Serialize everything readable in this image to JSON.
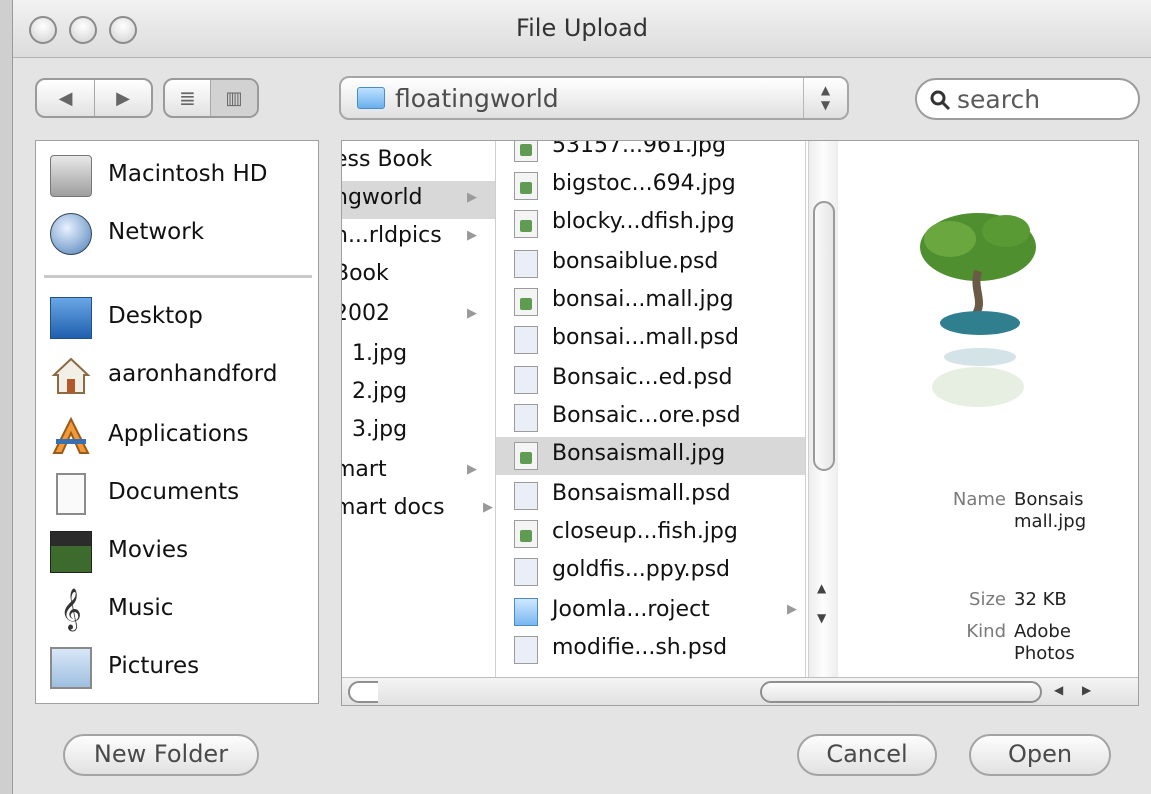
{
  "window": {
    "title": "File Upload"
  },
  "toolbar": {
    "path": "floatingworld",
    "search_placeholder": "search"
  },
  "sidebar": {
    "items": [
      {
        "label": "Macintosh HD",
        "icon": "hard-drive-icon"
      },
      {
        "label": "Network",
        "icon": "globe-icon"
      },
      {
        "label": "Desktop",
        "icon": "desktop-icon"
      },
      {
        "label": "aaronhandford",
        "icon": "home-icon"
      },
      {
        "label": "Applications",
        "icon": "applications-icon"
      },
      {
        "label": "Documents",
        "icon": "document-icon"
      },
      {
        "label": "Movies",
        "icon": "clapperboard-icon"
      },
      {
        "label": "Music",
        "icon": "music-note-icon"
      },
      {
        "label": "Pictures",
        "icon": "pictures-icon"
      }
    ]
  },
  "column1": [
    {
      "label": "ess Book",
      "arrow": ""
    },
    {
      "label": "ngworld",
      "arrow": "▶"
    },
    {
      "label": "n...rldpics",
      "arrow": "▶"
    },
    {
      "label": "Book",
      "arrow": ""
    },
    {
      "label": "2002",
      "arrow": "▶"
    },
    {
      "label": "1.jpg",
      "arrow": ""
    },
    {
      "label": "2.jpg",
      "arrow": ""
    },
    {
      "label": "3.jpg",
      "arrow": ""
    },
    {
      "label": "mart",
      "arrow": "▶"
    },
    {
      "label": "mart docs",
      "arrow": "▶"
    }
  ],
  "column2": [
    {
      "label": "53157...961.jpg",
      "kind": "img"
    },
    {
      "label": "bigstoc...694.jpg",
      "kind": "img"
    },
    {
      "label": "blocky...dfish.jpg",
      "kind": "img"
    },
    {
      "label": "bonsaiblue.psd",
      "kind": "psd"
    },
    {
      "label": "bonsai...mall.jpg",
      "kind": "img"
    },
    {
      "label": "bonsai...mall.psd",
      "kind": "psd"
    },
    {
      "label": "Bonsaic...ed.psd",
      "kind": "psd"
    },
    {
      "label": "Bonsaic...ore.psd",
      "kind": "psd"
    },
    {
      "label": "Bonsaismall.jpg",
      "kind": "img",
      "selected": true
    },
    {
      "label": "Bonsaismall.psd",
      "kind": "psd"
    },
    {
      "label": "closeup...fish.jpg",
      "kind": "img"
    },
    {
      "label": "goldfis...ppy.psd",
      "kind": "psd"
    },
    {
      "label": "Joomla...roject",
      "kind": "folder",
      "arrow": "▶"
    },
    {
      "label": "modifie...sh.psd",
      "kind": "psd"
    }
  ],
  "preview": {
    "name_label": "Name",
    "name_value": "Bonsaismall.jpg",
    "size_label": "Size",
    "size_value": "32 KB",
    "kind_label": "Kind",
    "kind_value": "Adobe Photos"
  },
  "buttons": {
    "new_folder": "New Folder",
    "cancel": "Cancel",
    "open": "Open"
  }
}
